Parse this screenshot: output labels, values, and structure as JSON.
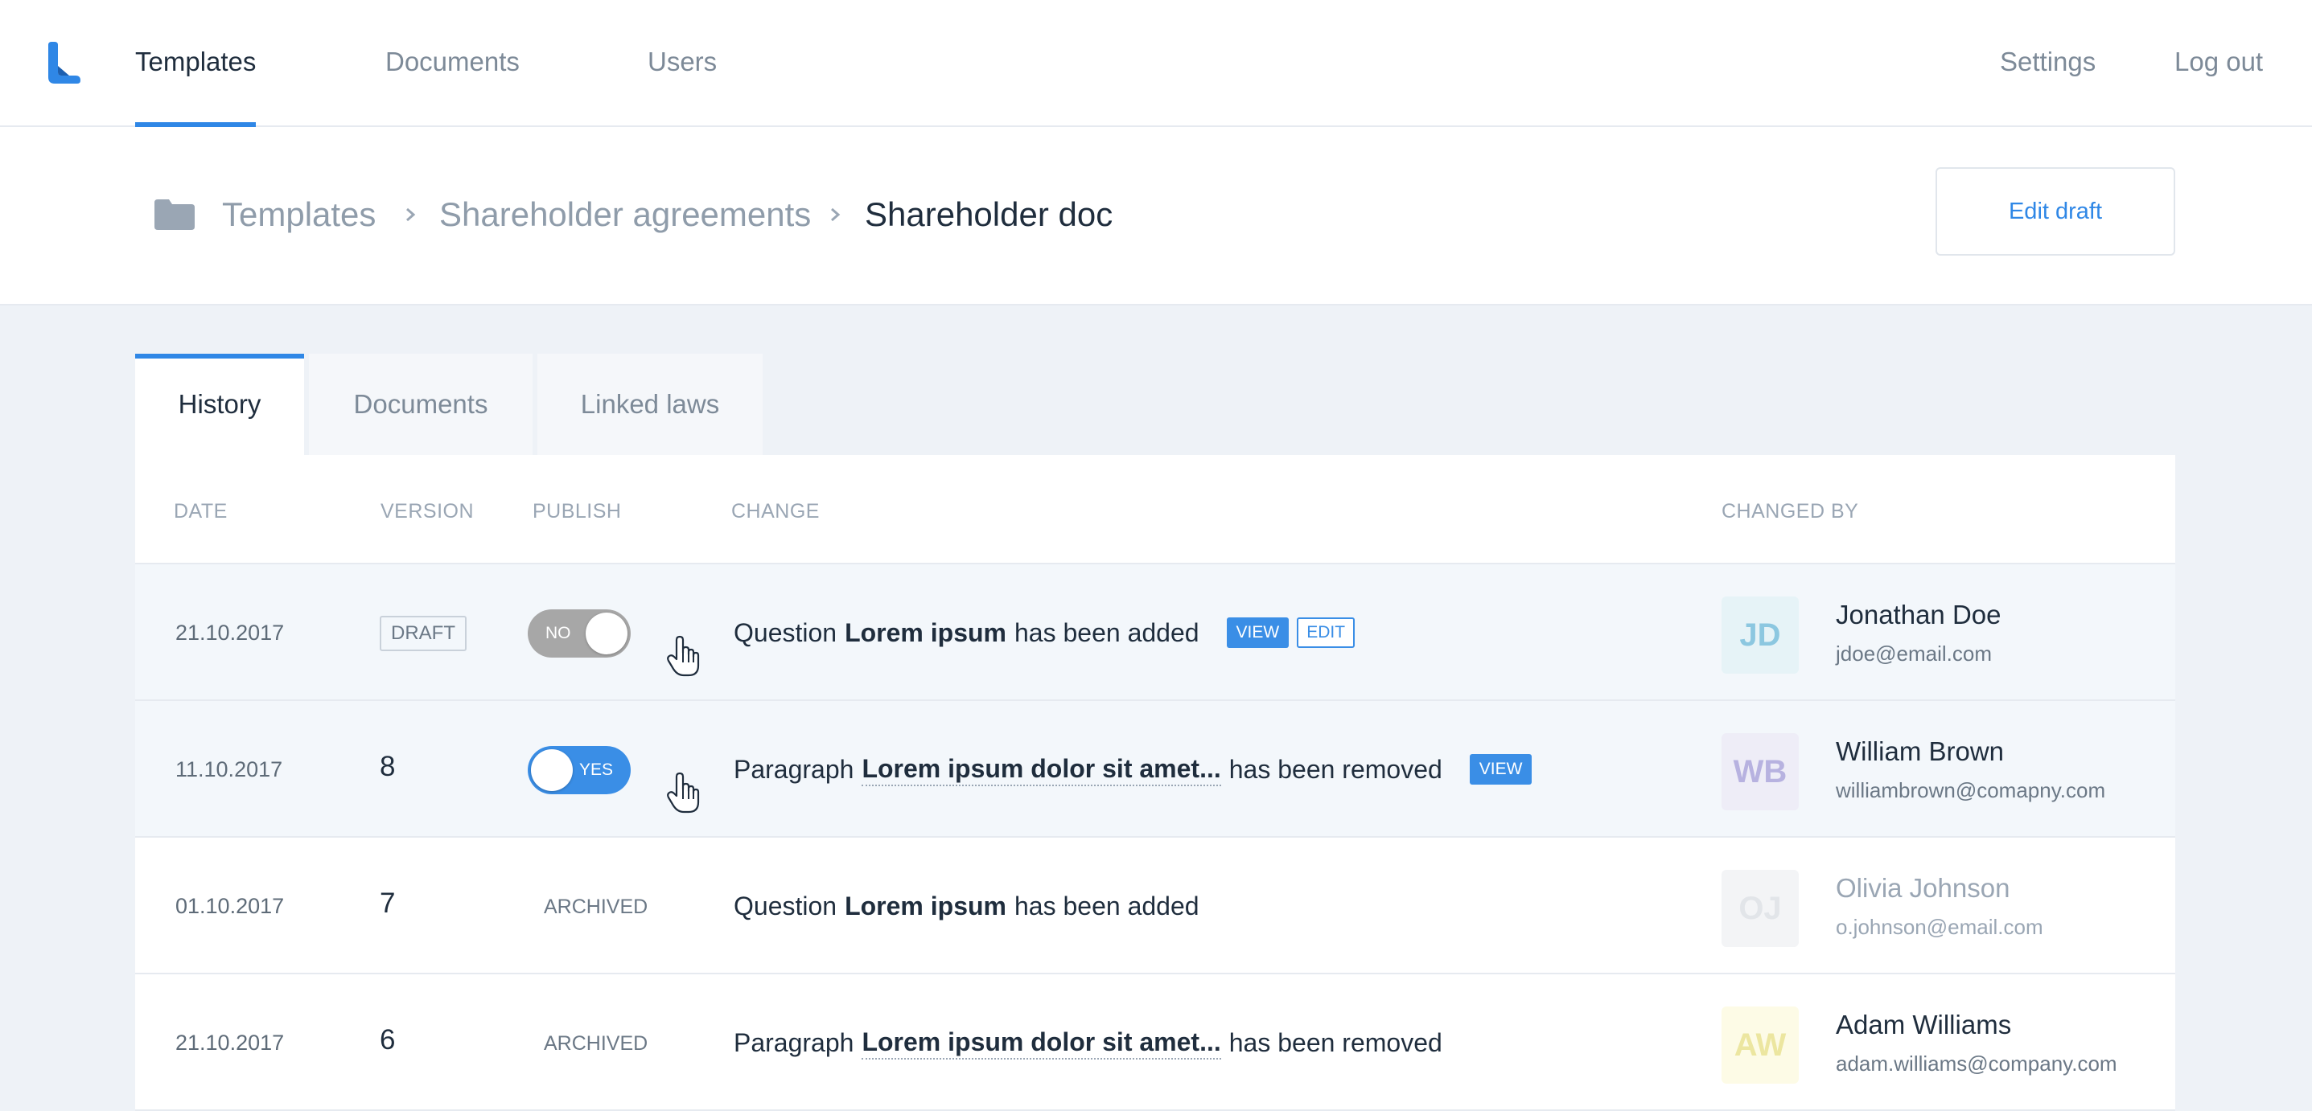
{
  "nav": {
    "items": [
      {
        "label": "Templates",
        "active": true
      },
      {
        "label": "Documents",
        "active": false
      },
      {
        "label": "Users",
        "active": false
      }
    ],
    "settings": "Settings",
    "logout": "Log out"
  },
  "breadcrumb": {
    "items": [
      "Templates",
      "Shareholder agreements"
    ],
    "current": "Shareholder doc"
  },
  "edit_draft_label": "Edit draft",
  "tabs": [
    {
      "label": "History",
      "active": true
    },
    {
      "label": "Documents",
      "active": false
    },
    {
      "label": "Linked laws",
      "active": false
    }
  ],
  "table": {
    "headers": {
      "date": "DATE",
      "version": "VERSION",
      "publish": "PUBLISH",
      "change": "CHANGE",
      "changed_by": "CHANGED BY"
    },
    "rows": [
      {
        "date": "21.10.2017",
        "version": "DRAFT",
        "publish": {
          "toggle": "NO"
        },
        "change": {
          "prefix": "Question",
          "subject": "Lorem ipsum",
          "suffix": "has been added",
          "view": "VIEW",
          "edit": "EDIT"
        },
        "user": {
          "initials": "JD",
          "name": "Jonathan Doe",
          "email": "jdoe@email.com"
        }
      },
      {
        "date": "11.10.2017",
        "version": "8",
        "publish": {
          "toggle": "YES"
        },
        "change": {
          "prefix": "Paragraph",
          "subject": "Lorem ipsum dolor sit amet...",
          "suffix": "has been removed",
          "view": "VIEW"
        },
        "user": {
          "initials": "WB",
          "name": "William Brown",
          "email": "williambrown@comapny.com"
        }
      },
      {
        "date": "01.10.2017",
        "version": "7",
        "publish": {
          "status": "ARCHIVED"
        },
        "change": {
          "prefix": "Question",
          "subject": "Lorem ipsum",
          "suffix": "has been added"
        },
        "user": {
          "initials": "OJ",
          "name": "Olivia Johnson",
          "email": "o.johnson@email.com"
        }
      },
      {
        "date": "21.10.2017",
        "version": "6",
        "publish": {
          "status": "ARCHIVED"
        },
        "change": {
          "prefix": "Paragraph",
          "subject": "Lorem ipsum dolor sit amet...",
          "suffix": "has been removed"
        },
        "user": {
          "initials": "AW",
          "name": "Adam Williams",
          "email": "adam.williams@company.com"
        }
      }
    ]
  },
  "colors": {
    "accent": "#2f87e6",
    "toggle_off": "#a7a7a7",
    "avatar_jd_bg": "#e6f3f7",
    "avatar_jd_fg": "#8cc7e0",
    "avatar_wb_bg": "#eeedf7",
    "avatar_wb_fg": "#b7b2e0",
    "avatar_oj_bg": "#f3f4f6",
    "avatar_oj_fg": "#e2e5e9",
    "avatar_aw_bg": "#fdfbe6",
    "avatar_aw_fg": "#ece6a0"
  },
  "icons": {
    "logo": "app-logo",
    "folder": "folder-icon",
    "breadcrumb_sep": "chevron-right-icon",
    "pointer": "hand-pointer-icon"
  }
}
